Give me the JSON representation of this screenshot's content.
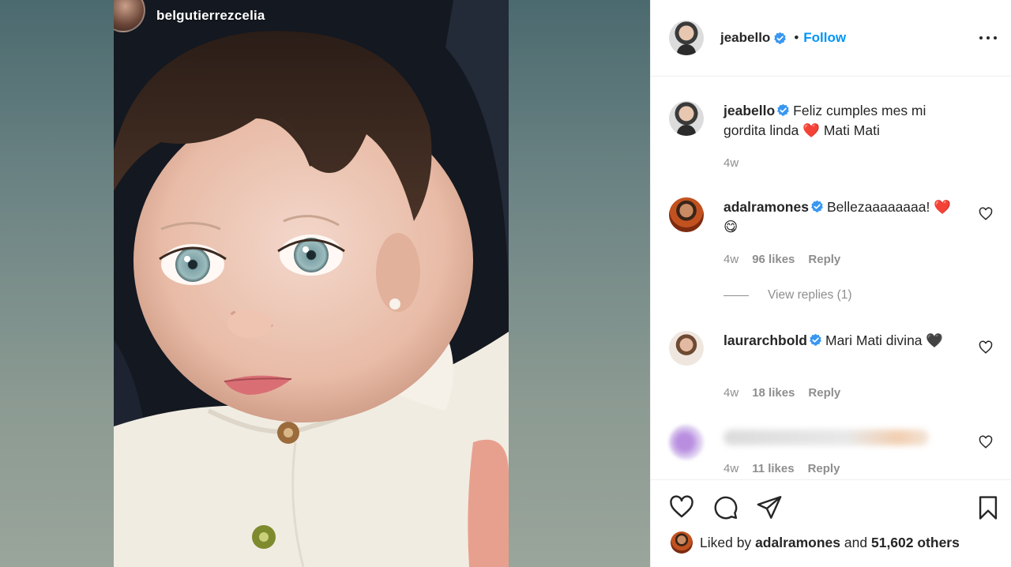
{
  "story": {
    "username": "belgutierrezcelia"
  },
  "post": {
    "username": "jeabello",
    "follow_label": "Follow",
    "separator": "•"
  },
  "caption": {
    "username": "jeabello",
    "text": "Feliz cumples mes mi gordita linda ❤️ Mati Mati",
    "time": "4w"
  },
  "comments": [
    {
      "username": "adalramones",
      "text": "Bellezaaaaaaaa! ❤️😋",
      "time": "4w",
      "likes": "96 likes",
      "reply_label": "Reply",
      "view_replies": "View replies (1)"
    },
    {
      "username": "laurarchbold",
      "text": "Mari Mati divina 🖤",
      "time": "4w",
      "likes": "18 likes",
      "reply_label": "Reply"
    },
    {
      "username": "",
      "text": "",
      "time": "4w",
      "likes": "11 likes",
      "reply_label": "Reply"
    }
  ],
  "likes_summary": {
    "prefix": "Liked by",
    "user": "adalramones",
    "middle": "and",
    "others": "51,602 others"
  },
  "colors": {
    "accent": "#0095f6",
    "verified": "#3897f0",
    "text": "#262626",
    "muted": "#8e8e8e"
  },
  "icons": [
    "verified-badge-icon",
    "more-options-icon",
    "heart-icon",
    "comment-icon",
    "share-icon",
    "bookmark-icon"
  ]
}
